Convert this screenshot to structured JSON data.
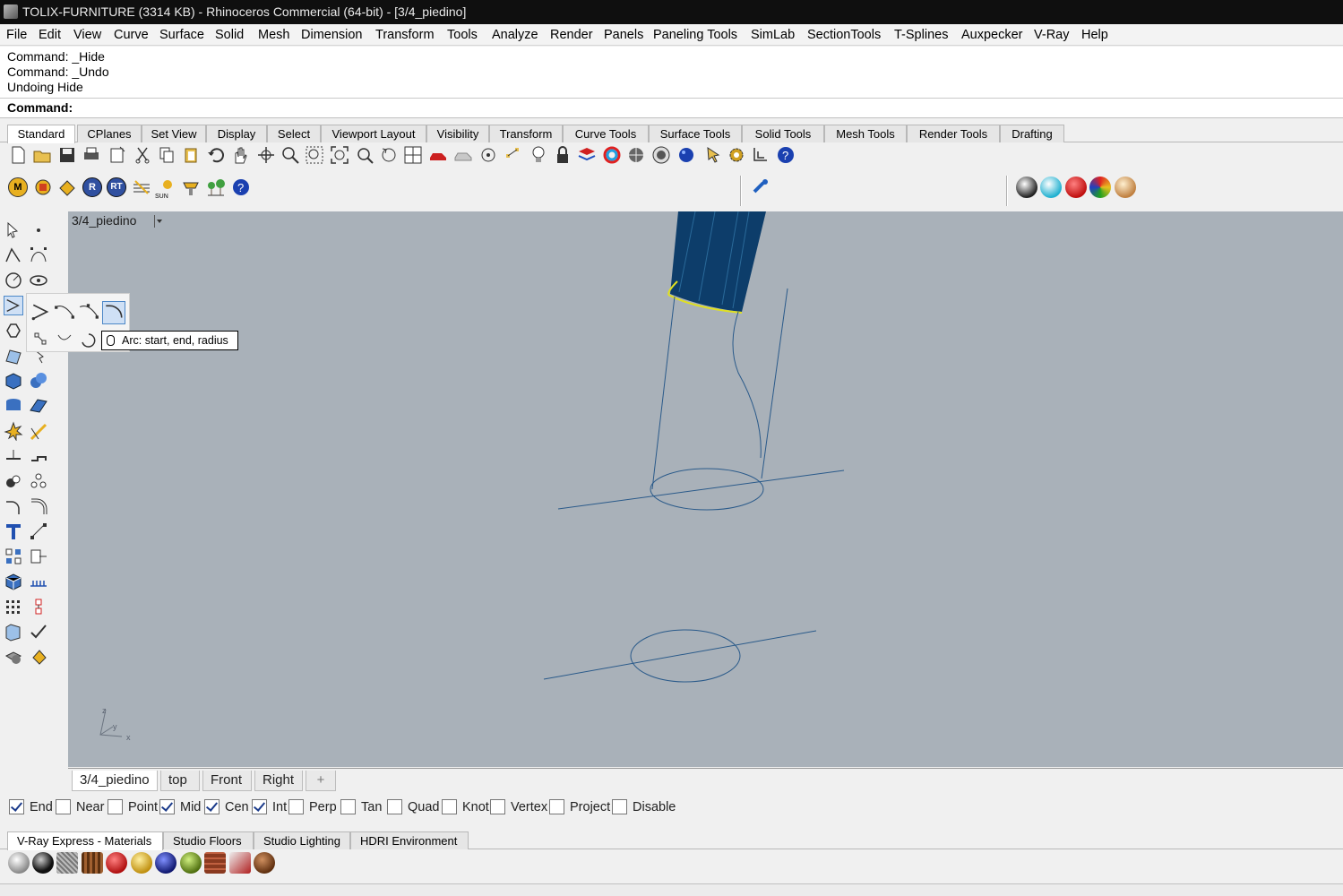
{
  "window": {
    "title": "TOLIX-FURNITURE (3314 KB) - Rhinoceros Commercial (64-bit) - [3/4_piedino]"
  },
  "menu": [
    "File",
    "Edit",
    "View",
    "Curve",
    "Surface",
    "Solid",
    "Mesh",
    "Dimension",
    "Transform",
    "Tools",
    "Analyze",
    "Render",
    "Panels",
    "Paneling Tools",
    "SimLab",
    "SectionTools",
    "T-Splines",
    "Auxpecker",
    "V-Ray",
    "Help"
  ],
  "command_history": [
    "Command: _Hide",
    "Command: _Undo",
    "Undoing Hide"
  ],
  "command_prompt": "Command:",
  "toolbar_tabs": [
    "Standard",
    "CPlanes",
    "Set View",
    "Display",
    "Select",
    "Viewport Layout",
    "Visibility",
    "Transform",
    "Curve Tools",
    "Surface Tools",
    "Solid Tools",
    "Mesh Tools",
    "Render Tools",
    "Drafting"
  ],
  "vray_toolbar": {
    "m_label": "M",
    "r_label": "R",
    "rt_label": "RT",
    "sun_label": "SUN"
  },
  "viewport": {
    "label": "3/4_piedino",
    "axes": {
      "z": "z",
      "y": "y",
      "x": "x"
    }
  },
  "tooltip": "Arc: start, end, radius",
  "view_tabs": [
    "3/4_piedino",
    "top",
    "Front",
    "Right",
    "+"
  ],
  "osnaps": [
    {
      "label": "End",
      "checked": true
    },
    {
      "label": "Near",
      "checked": false
    },
    {
      "label": "Point",
      "checked": false
    },
    {
      "label": "Mid",
      "checked": true
    },
    {
      "label": "Cen",
      "checked": true
    },
    {
      "label": "Int",
      "checked": true
    },
    {
      "label": "Perp",
      "checked": false
    },
    {
      "label": "Tan",
      "checked": false
    },
    {
      "label": "Quad",
      "checked": false
    },
    {
      "label": "Knot",
      "checked": false
    },
    {
      "label": "Vertex",
      "checked": false
    },
    {
      "label": "Project",
      "checked": false
    },
    {
      "label": "Disable",
      "checked": false
    }
  ],
  "material_tabs": [
    "V-Ray Express - Materials",
    "Studio Floors",
    "Studio Lighting",
    "HDRI Environment"
  ],
  "colors": {
    "titlebar": "#0f0f0f",
    "viewport_bg": "#a9b1b9",
    "curve": "#2a5a8a",
    "solid": "#0d3d6a",
    "highlight": "#e0e020"
  }
}
